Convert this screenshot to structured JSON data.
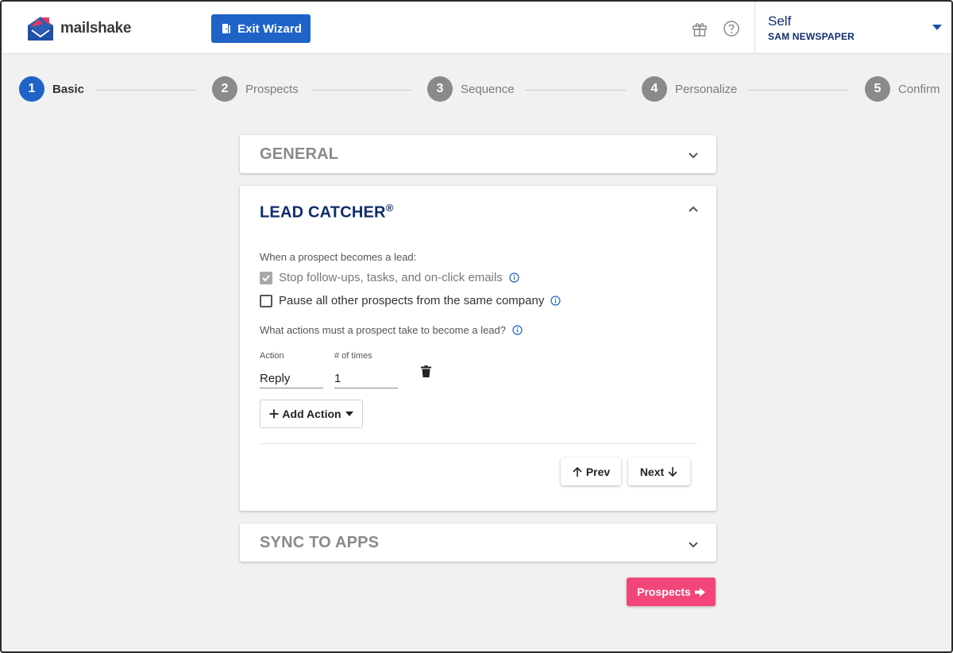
{
  "header": {
    "logo_text": "mailshake",
    "exit_label": "Exit Wizard",
    "account_name": "Self",
    "account_org": "SAM NEWSPAPER"
  },
  "steps": [
    {
      "number": "1",
      "label": "Basic",
      "active": true
    },
    {
      "number": "2",
      "label": "Prospects",
      "active": false
    },
    {
      "number": "3",
      "label": "Sequence",
      "active": false
    },
    {
      "number": "4",
      "label": "Personalize",
      "active": false
    },
    {
      "number": "5",
      "label": "Confirm",
      "active": false
    }
  ],
  "general": {
    "title": "GENERAL"
  },
  "lead_catcher": {
    "title": "LEAD CATCHER",
    "title_mark": "®",
    "intro": "When a prospect becomes a lead:",
    "option_stop": {
      "label": "Stop follow-ups, tasks, and on-click emails",
      "checked": true
    },
    "option_pause": {
      "label": "Pause all other prospects from the same company",
      "checked": false
    },
    "question": "What actions must a prospect take to become a lead?",
    "action_label": "Action",
    "action_value": "Reply",
    "times_label": "# of times",
    "times_value": "1",
    "add_action_label": "Add Action",
    "prev_label": "Prev",
    "next_label": "Next"
  },
  "sync": {
    "title": "SYNC TO APPS"
  },
  "footer": {
    "prospects_label": "Prospects"
  },
  "colors": {
    "primary": "#1f63c7",
    "accent": "#f2457a",
    "navy": "#0f2d6b"
  }
}
